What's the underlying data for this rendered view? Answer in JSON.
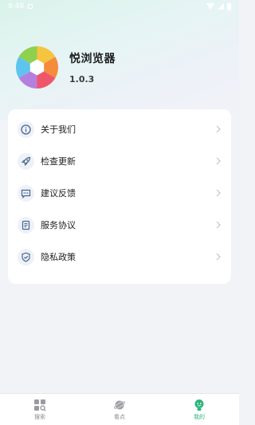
{
  "status_bar": {
    "time": "9:48"
  },
  "app": {
    "name": "悦浏览器",
    "version": "1.0.3"
  },
  "menu": {
    "items": [
      {
        "label": "关于我们",
        "icon": "info-icon"
      },
      {
        "label": "检查更新",
        "icon": "rocket-icon"
      },
      {
        "label": "建议反馈",
        "icon": "feedback-icon"
      },
      {
        "label": "服务协议",
        "icon": "document-icon"
      },
      {
        "label": "隐私政策",
        "icon": "shield-icon"
      }
    ]
  },
  "tabbar": {
    "tabs": [
      {
        "label": "搜索",
        "icon": "grid-search-icon",
        "active": false
      },
      {
        "label": "看点",
        "icon": "planet-icon",
        "active": false
      },
      {
        "label": "我的",
        "icon": "user-icon",
        "active": true
      }
    ]
  },
  "colors": {
    "accent": "#2bb57a",
    "icon_blue": "#4a6491"
  }
}
